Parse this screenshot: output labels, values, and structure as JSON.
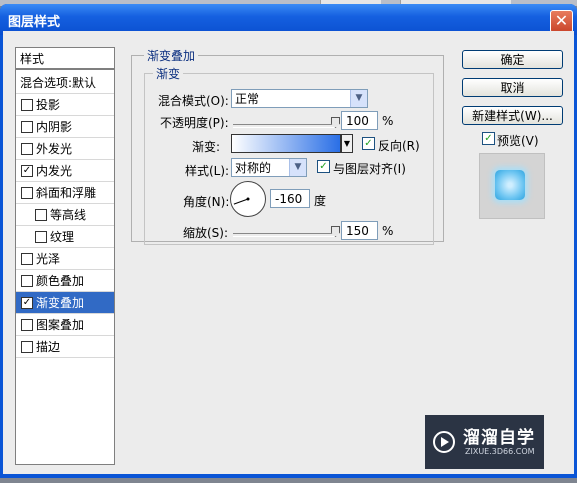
{
  "window": {
    "title": "图层样式",
    "close_glyph": "✕"
  },
  "styles_panel": {
    "header": "样式",
    "blend_defaults": "混合选项:默认",
    "items": [
      {
        "label": "投影",
        "checked": false
      },
      {
        "label": "内阴影",
        "checked": false
      },
      {
        "label": "外发光",
        "checked": false
      },
      {
        "label": "内发光",
        "checked": true
      },
      {
        "label": "斜面和浮雕",
        "checked": false
      },
      {
        "label": "等高线",
        "checked": false
      },
      {
        "label": "纹理",
        "checked": false
      },
      {
        "label": "光泽",
        "checked": false
      },
      {
        "label": "颜色叠加",
        "checked": false
      },
      {
        "label": "渐变叠加",
        "checked": true
      },
      {
        "label": "图案叠加",
        "checked": false
      },
      {
        "label": "描边",
        "checked": false
      }
    ],
    "check_glyph": "✓"
  },
  "gradient_overlay": {
    "outer_legend": "渐变叠加",
    "inner_legend": "渐变",
    "blend_mode_label": "混合模式(O):",
    "blend_mode_value": "正常",
    "opacity_label": "不透明度(P):",
    "opacity_value": "100",
    "opacity_unit": "%",
    "opacity_level": 100,
    "gradient_label": "渐变:",
    "gradient_colors": [
      "#ffffff",
      "#2a6fe6"
    ],
    "reverse_label": "反向(R)",
    "reverse_checked": true,
    "style_label": "样式(L):",
    "style_value": "对称的",
    "align_label": "与图层对齐(I)",
    "align_checked": true,
    "angle_label": "角度(N):",
    "angle_value": "-160",
    "angle_unit": "度",
    "scale_label": "缩放(S):",
    "scale_value": "150",
    "scale_unit": "%",
    "scale_level": 150
  },
  "buttons": {
    "ok": "确定",
    "cancel": "取消",
    "new_style": "新建样式(W)...",
    "preview_label": "预览(V)",
    "preview_checked": true
  },
  "watermark": {
    "brand": "溜溜自学",
    "url": "ZIXUE.3D66.COM"
  },
  "colors": {
    "titlebar": "#0a55d6",
    "selection": "#316ac5",
    "legend_text": "#0b2f80"
  },
  "icons": {
    "dropdown": "chevron-down-icon",
    "close": "close-icon",
    "logo": "play-icon"
  }
}
